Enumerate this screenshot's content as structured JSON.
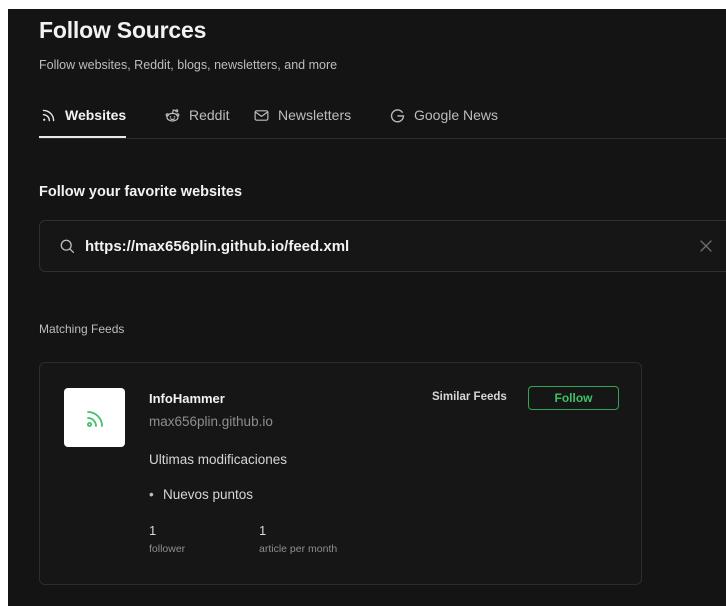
{
  "header": {
    "title": "Follow Sources",
    "subtitle": "Follow websites, Reddit, blogs, newsletters, and more"
  },
  "tabs": [
    {
      "label": "Websites",
      "icon": "rss-icon",
      "active": true
    },
    {
      "label": "Reddit",
      "icon": "reddit-icon",
      "active": false
    },
    {
      "label": "Newsletters",
      "icon": "mail-icon",
      "active": false
    },
    {
      "label": "Google News",
      "icon": "google-icon",
      "active": false
    }
  ],
  "section": {
    "heading": "Follow your favorite websites"
  },
  "search": {
    "value": "https://max656plin.github.io/feed.xml",
    "icon": "search-icon",
    "clear_icon": "close-icon"
  },
  "results": {
    "label": "Matching Feeds",
    "feeds": [
      {
        "name": "InfoHammer",
        "domain": "max656plin.github.io",
        "description": "Ultimas modificaciones",
        "bullets": [
          "Nuevos puntos"
        ],
        "stats": [
          {
            "value": "1",
            "label": "follower"
          },
          {
            "value": "1",
            "label": "article per month"
          }
        ],
        "similar_label": "Similar Feeds",
        "follow_label": "Follow"
      }
    ]
  },
  "colors": {
    "background": "#141414",
    "accent_green": "#3fc166",
    "border": "#2c2c2c"
  }
}
